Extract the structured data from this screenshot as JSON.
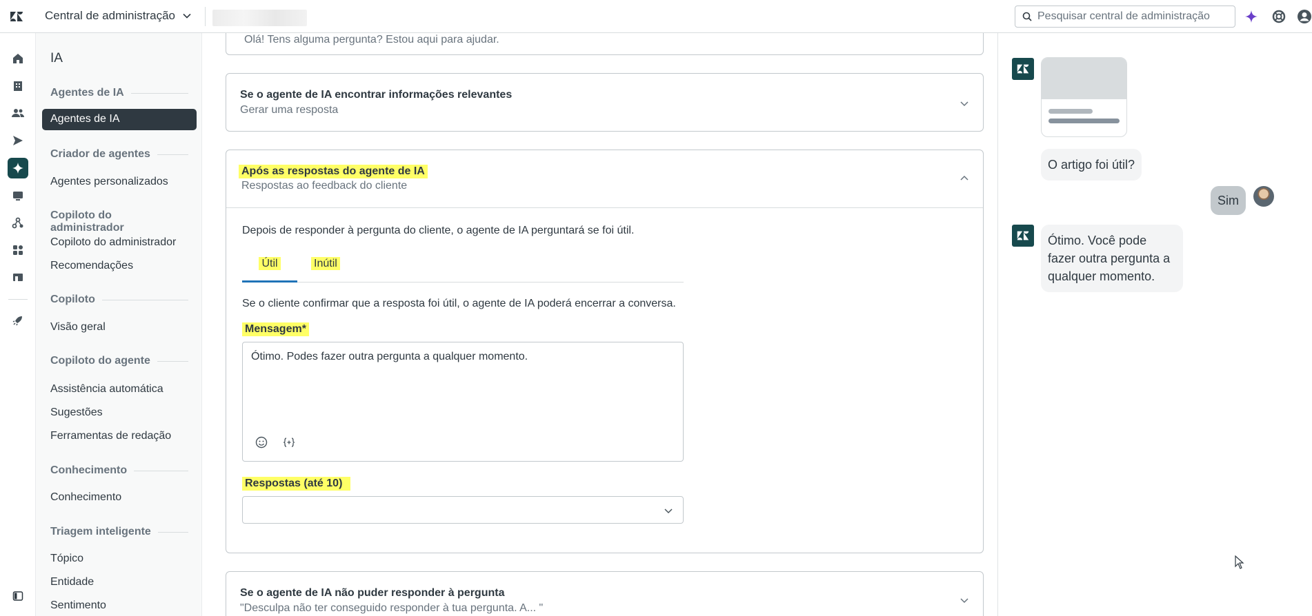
{
  "topbar": {
    "title": "Central de administração",
    "search_placeholder": "Pesquisar central de administração"
  },
  "sidebar": {
    "title": "IA",
    "sections": [
      {
        "label": "Agentes de IA",
        "items": [
          "Agentes de IA"
        ]
      },
      {
        "label": "Criador de agentes",
        "items": [
          "Agentes personalizados"
        ]
      },
      {
        "label": "Copiloto do administrador",
        "items": [
          "Copiloto do administrador",
          "Recomendações"
        ]
      },
      {
        "label": "Copiloto",
        "items": [
          "Visão geral"
        ]
      },
      {
        "label": "Copiloto do agente",
        "items": [
          "Assistência automática",
          "Sugestões",
          "Ferramentas de redação"
        ]
      },
      {
        "label": "Conhecimento",
        "items": [
          "Conhecimento"
        ]
      },
      {
        "label": "Triagem inteligente",
        "items": [
          "Tópico",
          "Entidade",
          "Sentimento"
        ]
      }
    ]
  },
  "main": {
    "top_card_text": "Olá! Tens alguma pergunta? Estou aqui para ajudar.",
    "card_relevant": {
      "title": "Se o agente de IA encontrar informações relevantes",
      "subtitle": "Gerar uma resposta"
    },
    "card_after": {
      "title": "Após as respostas do agente de IA",
      "subtitle": "Respostas ao feedback do cliente",
      "intro": "Depois de responder à pergunta do cliente, o agente de IA perguntará se foi útil.",
      "tabs": [
        "Útil",
        "Inútil"
      ],
      "description": "Se o cliente confirmar que a resposta foi útil, o agente de IA poderá encerrar a conversa.",
      "message_label": "Mensagem*",
      "message_value": "Ótimo. Podes fazer outra pergunta a qualquer momento.",
      "replies_label": "Respostas (até 10)",
      "replies_value": ""
    },
    "card_cannot": {
      "title": "Se o agente de IA não puder responder à pergunta",
      "subtitle": "\"Desculpa não ter conseguido responder à tua pergunta. A... \""
    }
  },
  "preview": {
    "question": "O artigo foi útil?",
    "user_reply": "Sim",
    "bot_reply": "Ótimo. Você pode fazer outra pergunta a qualquer momento."
  },
  "colors": {
    "brand": "#17494d",
    "highlight": "#ffff66",
    "tab_active": "#1f73b7",
    "ai_sparkle": "#6a3fc9"
  }
}
